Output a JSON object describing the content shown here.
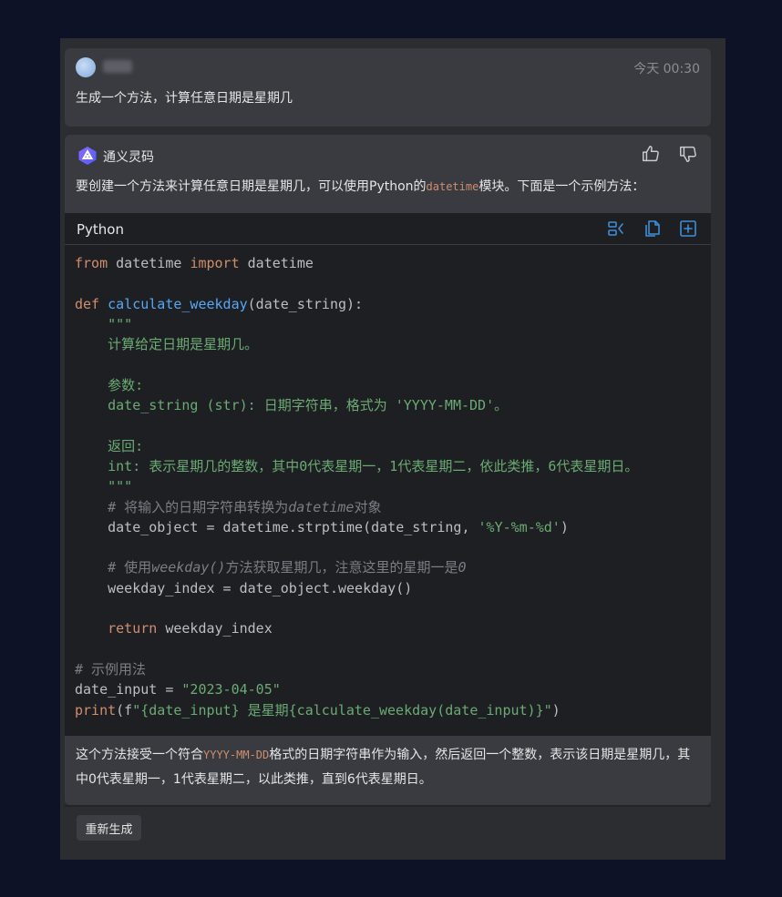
{
  "user": {
    "name": "",
    "timestamp": "今天 00:30",
    "message": "生成一个方法，计算任意日期是星期几"
  },
  "assistant": {
    "name": "通义灵码",
    "intro_prefix": "要创建一个方法来计算任意日期是星期几，可以使用Python的",
    "intro_code": "datetime",
    "intro_suffix": "模块。下面是一个示例方法：",
    "outro_prefix": "这个方法接受一个符合",
    "outro_code": "YYYY-MM-DD",
    "outro_suffix": "格式的日期字符串作为输入，然后返回一个整数，表示该日期是星期几，其中0代表星期一，1代表星期二，以此类推，直到6代表星期日。"
  },
  "code": {
    "language": "Python",
    "t": {
      "from": "from",
      "l1a": " datetime ",
      "import": "import",
      "l1b": " datetime",
      "def": "def",
      "fn": "calculate_weekday",
      "params": "(date_string):",
      "doc_open": "\"\"\"",
      "doc1": "计算给定日期是星期几。",
      "doc2": "参数:",
      "doc3": "date_string (str): 日期字符串，格式为 'YYYY-MM-DD'。",
      "doc4": "返回:",
      "doc5": "int: 表示星期几的整数，其中0代表星期一，1代表星期二，依此类推，6代表星期日。",
      "doc_close": "\"\"\"",
      "c1a": "# 将输入的日期字符串转换为",
      "c1b": "datetime",
      "c1c": "对象",
      "l_obj_a": "date_object = datetime.strptime(date_string, ",
      "l_obj_str": "'%Y-%m-%d'",
      "l_obj_b": ")",
      "c2a": "# 使用",
      "c2b": "weekday()",
      "c2c": "方法获取星期几，注意这里的星期一是",
      "c2d": "0",
      "l_idx": "weekday_index = date_object.weekday()",
      "return": "return",
      "ret_val": " weekday_index",
      "c3": "# 示例用法",
      "l_in_a": "date_input = ",
      "l_in_str": "\"2023-04-05\"",
      "print": "print",
      "pr_a": "(f",
      "pr_str": "\"{date_input} 是星期{calculate_weekday(date_input)}\"",
      "pr_b": ")"
    }
  },
  "actions": {
    "regenerate_label": "重新生成"
  },
  "colors": {
    "background": "#0d1226",
    "card": "#393b40",
    "code_bg": "#1e1f22",
    "keyword": "#cf8e6d",
    "function": "#56a8f5",
    "string": "#6aab73",
    "comment": "#7a7e85",
    "tool_icon": "#3d8fd8"
  },
  "icons": {
    "logo": "tongyi-logo-icon",
    "thumbs_up": "thumbs-up-icon",
    "thumbs_down": "thumbs-down-icon",
    "insert": "insert-diff-icon",
    "copy": "copy-icon",
    "new_file": "new-file-icon"
  }
}
